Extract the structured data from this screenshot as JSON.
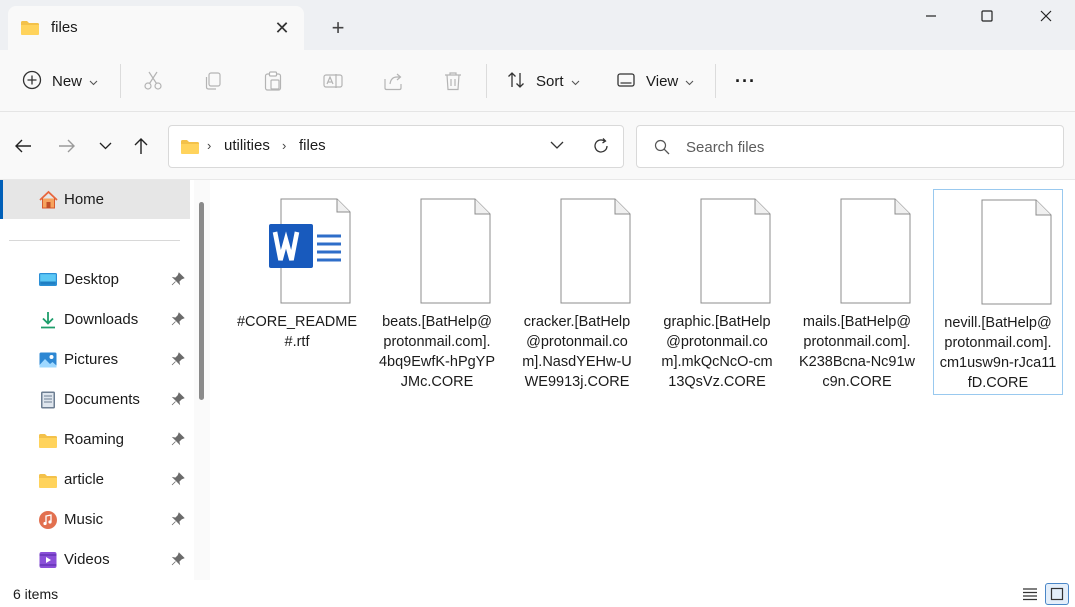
{
  "window": {
    "tab_title": "files",
    "close_tab_label": "✕",
    "new_tab_label": "+"
  },
  "toolbar": {
    "new_label": "New",
    "sort_label": "Sort",
    "view_label": "View",
    "more_label": "···",
    "icons": [
      "scissors-icon",
      "copy-icon",
      "paste-icon",
      "rename-icon",
      "share-icon",
      "delete-icon"
    ]
  },
  "address": {
    "breadcrumbs": [
      "utilities",
      "files"
    ],
    "separator": "›"
  },
  "search": {
    "placeholder": "Search files"
  },
  "sidebar": {
    "home_label": "Home",
    "items": [
      {
        "label": "Desktop",
        "icon": "desktop-icon"
      },
      {
        "label": "Downloads",
        "icon": "download-icon"
      },
      {
        "label": "Pictures",
        "icon": "pictures-icon"
      },
      {
        "label": "Documents",
        "icon": "documents-icon"
      },
      {
        "label": "Roaming",
        "icon": "folder-icon"
      },
      {
        "label": "article",
        "icon": "folder-icon"
      },
      {
        "label": "Music",
        "icon": "music-icon"
      },
      {
        "label": "Videos",
        "icon": "videos-icon"
      }
    ]
  },
  "files": [
    {
      "name": "#CORE_README\n#.rtf",
      "type": "word"
    },
    {
      "name": "beats.[BatHelp@\nprotonmail.com].\n4bq9EwfK-hPgYP\nJMc.CORE",
      "type": "generic"
    },
    {
      "name": "cracker.[BatHelp\n@protonmail.co\nm].NasdYEHw-U\nWE9913j.CORE",
      "type": "generic"
    },
    {
      "name": "graphic.[BatHelp\n@protonmail.co\nm].mkQcNcO-cm\n13QsVz.CORE",
      "type": "generic"
    },
    {
      "name": "mails.[BatHelp@\nprotonmail.com].\nK238Bcna-Nc91w\nc9n.CORE",
      "type": "generic"
    },
    {
      "name": "nevill.[BatHelp@\nprotonmail.com].\ncm1usw9n-rJca11\nfD.CORE",
      "type": "generic",
      "selected": true
    }
  ],
  "status": {
    "item_count": "6 items"
  },
  "colors": {
    "accent": "#005fb8",
    "folder": "#f3c14a",
    "word_blue": "#185abd"
  }
}
